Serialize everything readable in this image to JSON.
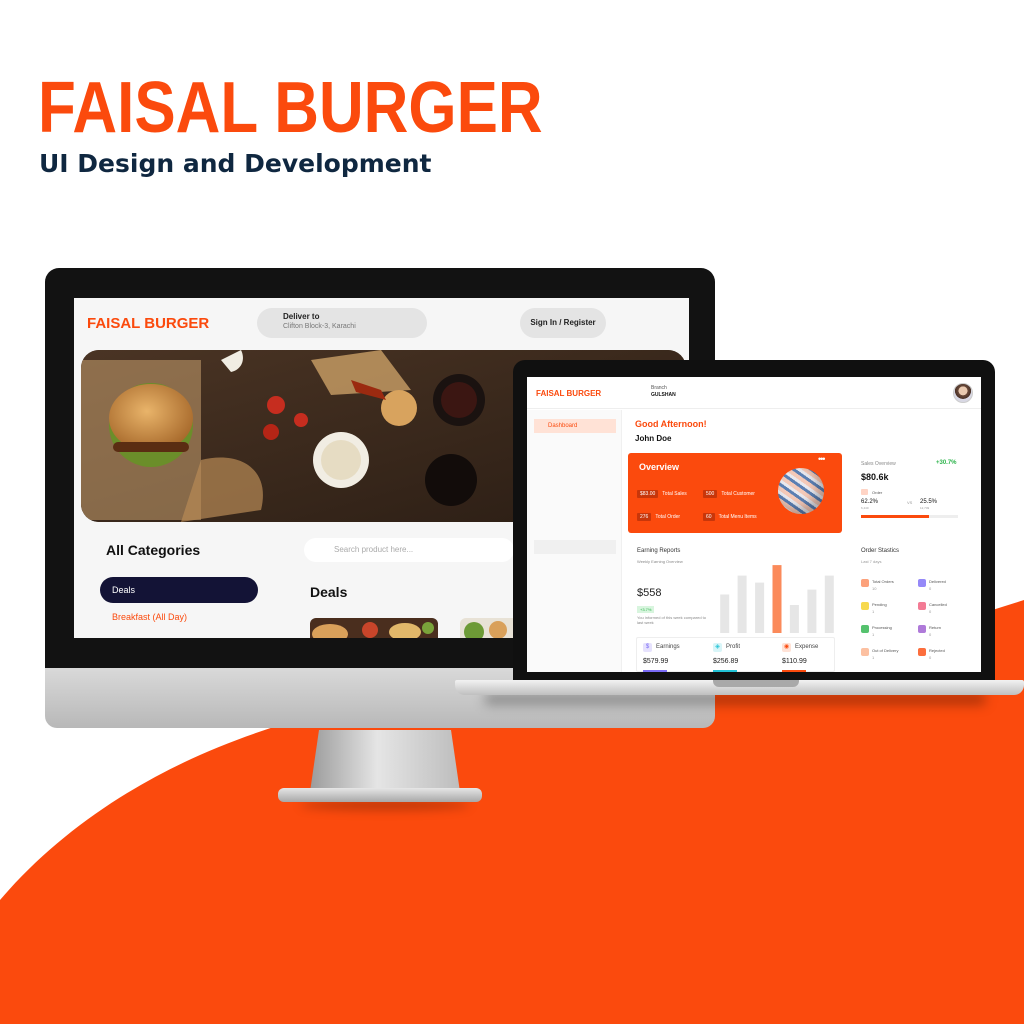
{
  "headline": {
    "title": "FAISAL BURGER",
    "subtitle": "UI Design and Development"
  },
  "colors": {
    "brand_orange": "#fb4a0d",
    "navy": "#0f2740",
    "dark_pill": "#131336"
  },
  "website": {
    "logo": "FAISAL BURGER",
    "deliver_label": "Deliver to",
    "deliver_address": "Clifton Block-3, Karachi",
    "signin_label": "Sign In / Register",
    "categories_title": "All Categories",
    "search_placeholder": "Search product here...",
    "categories": [
      {
        "label": "Deals",
        "active": true
      },
      {
        "label": "Breakfast (All Day)",
        "active": false
      }
    ],
    "deals_title": "Deals"
  },
  "dashboard": {
    "logo": "FAISAL BURGER",
    "branch_label": "Branch",
    "branch_name": "GULSHAN",
    "sidebar": [
      {
        "label": "Dashboard",
        "active": true
      }
    ],
    "greeting": "Good Afternoon!",
    "user_name": "John Doe",
    "overview": {
      "title": "Overview",
      "dots": "•••",
      "stats": [
        {
          "value": "$83.00",
          "label": "Total Sales"
        },
        {
          "value": "500",
          "label": "Total Customer"
        },
        {
          "value": "276",
          "label": "Total Order"
        },
        {
          "value": "60",
          "label": "Total Menu Items"
        }
      ]
    },
    "sales_overview": {
      "title": "Sales Overview",
      "growth": "+30.7%",
      "value": "$80.6k",
      "order_label": "Order",
      "order_pct": "62.2%",
      "order_sub": "6,440",
      "vs": "VS",
      "visit_pct": "25.5%",
      "visit_sub": "12,749",
      "progress": 0.7
    },
    "earning_reports": {
      "title": "Earning Reports",
      "subtitle": "Weekly Earning Overview",
      "value": "$558",
      "badge": "+3.7%",
      "note": "You informed of this week compared to last week",
      "bars": [
        0.55,
        0.82,
        0.72,
        0.97,
        0.4,
        0.62,
        0.82
      ],
      "highlight_index": 3,
      "mini_stats": [
        {
          "label": "Earnings",
          "value": "$579.99",
          "icon": "dollar-icon",
          "color": "#7b6cf6"
        },
        {
          "label": "Profit",
          "value": "$256.89",
          "icon": "chart-pie-icon",
          "color": "#22c3d6"
        },
        {
          "label": "Expense",
          "value": "$110.99",
          "icon": "brand-icon",
          "color": "#fb4a0d"
        }
      ]
    },
    "order_stats": {
      "title": "Order Stastics",
      "subtitle": "Last 7 days",
      "items": [
        {
          "label": "Total Orders",
          "count": "10",
          "color": "#fb8a5a"
        },
        {
          "label": "Delivered",
          "count": "0",
          "color": "#7b6cf6"
        },
        {
          "label": "Pending",
          "count": "1",
          "color": "#f5d020"
        },
        {
          "label": "Cancelled",
          "count": "0",
          "color": "#f05a7a"
        },
        {
          "label": "Processing",
          "count": "1",
          "color": "#2bb34a"
        },
        {
          "label": "Return",
          "count": "0",
          "color": "#9b59d0"
        },
        {
          "label": "Out of Delivery",
          "count": "1",
          "color": "#fbb08a"
        },
        {
          "label": "Rejected",
          "count": "0",
          "color": "#fb4a0d"
        }
      ]
    }
  }
}
